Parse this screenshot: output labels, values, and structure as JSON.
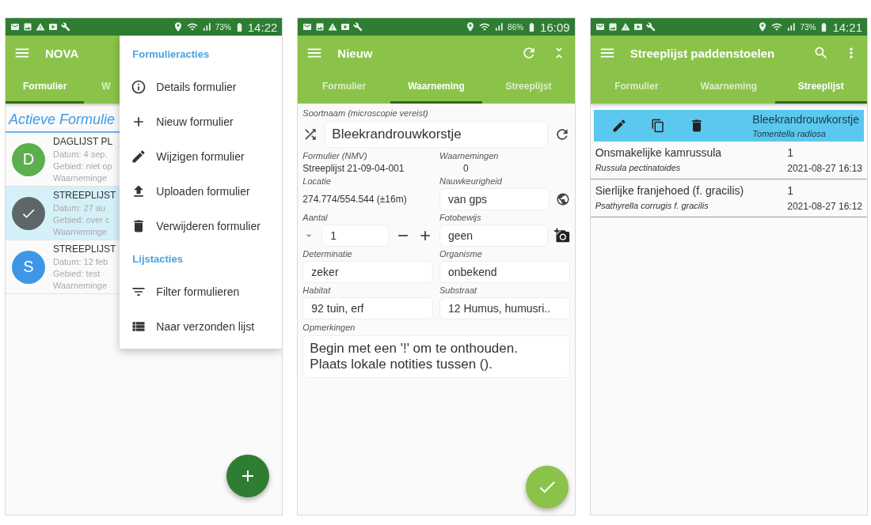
{
  "forms_screen": {
    "status": {
      "battery": "73%",
      "time": "14:22"
    },
    "title": "NOVA",
    "tabs": [
      {
        "label": "Formulier",
        "selected": true
      },
      {
        "label": "W",
        "selected": false
      }
    ],
    "list_heading": "Actieve Formulie",
    "forms": [
      {
        "avatar": "D",
        "color": "#5cae4f",
        "selected": false,
        "title": "DAGLIJST PL",
        "lines": [
          "Datum: 4 sep.",
          "Gebied: niet op",
          "Waarneminge"
        ]
      },
      {
        "color": "#5d6767",
        "selected": true,
        "title": "STREEPLIJST",
        "lines": [
          "Datum: 27 au",
          "Gebied: over c",
          "Waarneminge"
        ]
      },
      {
        "avatar": "S",
        "color": "#3d96e6",
        "selected": false,
        "title": "STREEPLIJST",
        "lines": [
          "Datum: 12 feb",
          "Gebied: test",
          "Waarneminge"
        ]
      }
    ],
    "menu": [
      {
        "heading": "Formulieracties",
        "items": [
          {
            "label": "Details formulier",
            "kind": "info"
          },
          {
            "label": "Nieuw formulier",
            "kind": "add"
          },
          {
            "label": "Wijzigen formulier",
            "kind": "edit"
          },
          {
            "label": "Uploaden formulier",
            "kind": "upload"
          },
          {
            "label": "Verwijderen formulier",
            "kind": "delete"
          }
        ]
      },
      {
        "heading": "Lijstacties",
        "items": [
          {
            "label": "Filter formulieren",
            "kind": "filter"
          },
          {
            "label": "Naar verzonden lijst",
            "kind": "list"
          }
        ]
      }
    ]
  },
  "observation_screen": {
    "status": {
      "battery": "86%",
      "time": "16:09"
    },
    "title": "Nieuw",
    "tabs": [
      {
        "label": "Formulier",
        "selected": false
      },
      {
        "label": "Waarneming",
        "selected": true
      },
      {
        "label": "Streeplijst",
        "selected": false
      }
    ],
    "species": {
      "label": "Soortnaam (microscopie vereist)",
      "value": "Bleekrandrouwkorstje"
    },
    "form": {
      "label": "Formulier (NMV)",
      "value": "Streeplijst 21-09-04-001"
    },
    "observations": {
      "label": "Waarnemingen",
      "value": "0"
    },
    "location": {
      "label": "Locatie",
      "value": "274.774/554.544 (±16m)"
    },
    "accuracy": {
      "label": "Nauwkeurigheid",
      "value": "van gps"
    },
    "count": {
      "label": "Aantal",
      "value": "1"
    },
    "photo": {
      "label": "Fotobewijs",
      "value": "geen"
    },
    "determination": {
      "label": "Determinatie",
      "value": "zeker"
    },
    "organism": {
      "label": "Organisme",
      "value": "onbekend"
    },
    "habitat": {
      "label": "Habitat",
      "value": "92 tuin, erf"
    },
    "substrate": {
      "label": "Substraat",
      "value": "12 Humus, humusri.."
    },
    "remarks": {
      "label": "Opmerkingen",
      "value": "Begin met een '!' om te onthouden.\nPlaats lokale notities tussen ()."
    }
  },
  "checklist_screen": {
    "status": {
      "battery": "73%",
      "time": "14:21"
    },
    "title": "Streeplijst paddenstoelen",
    "tabs": [
      {
        "label": "Formulier",
        "selected": false
      },
      {
        "label": "Waarneming",
        "selected": false
      },
      {
        "label": "Streeplijst",
        "selected": true
      }
    ],
    "selected_entry": {
      "name": "Bleekrandrouwkorstje",
      "latin": "Tomentella radiosa"
    },
    "entries": [
      {
        "name": "Onsmakelijke kamrussula",
        "count": "1",
        "latin": "Russula pectinatoides",
        "datetime": "2021-08-27 16:13"
      },
      {
        "name": "Sierlijke franjehoed (f. gracilis)",
        "count": "1",
        "latin": "Psathyrella corrugis f. gracilis",
        "datetime": "2021-08-27 16:12"
      }
    ]
  }
}
